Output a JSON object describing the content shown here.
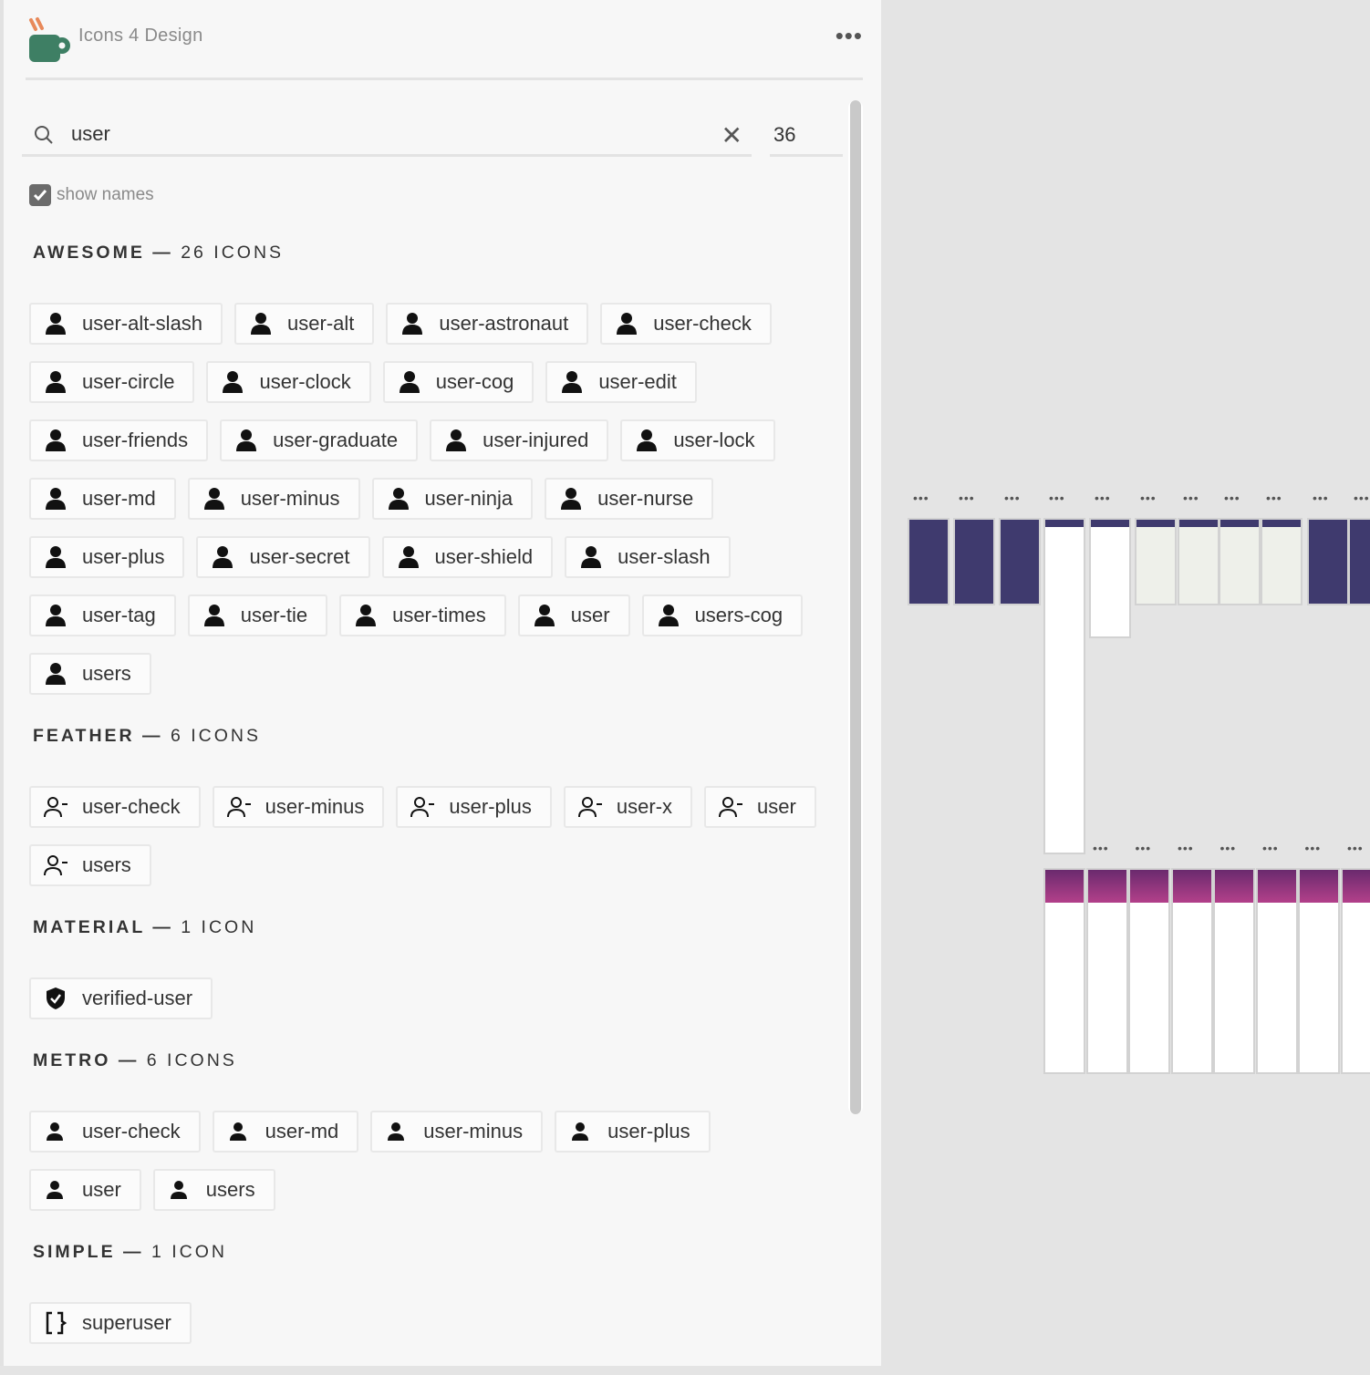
{
  "app": {
    "title": "Icons 4 Design",
    "menu_icon": "more-horizontal-icon",
    "brand_colors": {
      "cup": "#3e7f64",
      "steam": "#e8895a"
    }
  },
  "search": {
    "value": "user",
    "placeholder": "",
    "count": "36",
    "clear_icon": "close-icon"
  },
  "show_names": {
    "label": "show names",
    "checked": true
  },
  "sections": [
    {
      "name": "AWESOME",
      "count": "26 ICONS",
      "style": "solid",
      "icons": [
        "user-alt-slash",
        "user-alt",
        "user-astronaut",
        "user-check",
        "user-circle",
        "user-clock",
        "user-cog",
        "user-edit",
        "user-friends",
        "user-graduate",
        "user-injured",
        "user-lock",
        "user-md",
        "user-minus",
        "user-ninja",
        "user-nurse",
        "user-plus",
        "user-secret",
        "user-shield",
        "user-slash",
        "user-tag",
        "user-tie",
        "user-times",
        "user",
        "users-cog",
        "users"
      ]
    },
    {
      "name": "FEATHER",
      "count": "6 ICONS",
      "style": "outline",
      "icons": [
        "user-check",
        "user-minus",
        "user-plus",
        "user-x",
        "user",
        "users"
      ]
    },
    {
      "name": "MATERIAL",
      "count": "1 ICON",
      "style": "shield",
      "icons": [
        "verified-user"
      ]
    },
    {
      "name": "METRO",
      "count": "6 ICONS",
      "style": "solid-small",
      "icons": [
        "user-check",
        "user-md",
        "user-minus",
        "user-plus",
        "user",
        "users"
      ]
    },
    {
      "name": "SIMPLE",
      "count": "1 ICON",
      "style": "bracket",
      "icons": [
        "superuser"
      ]
    }
  ],
  "canvas": {
    "artboard_colors": {
      "dark": "#3f3a6e",
      "light": "#ffffff",
      "accent": "#d94fa6",
      "map": "#eef0ea"
    }
  }
}
